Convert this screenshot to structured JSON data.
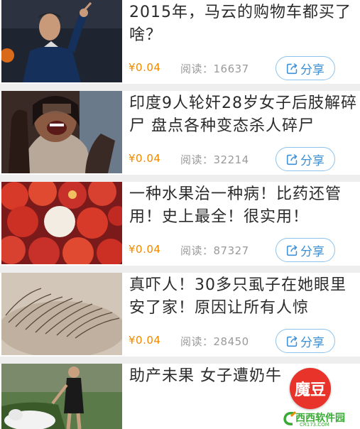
{
  "feed": {
    "items": [
      {
        "title": "2015年，马云的购物车都买了啥？",
        "price": "¥0.04",
        "reads": "阅读：16637",
        "share_label": "分享",
        "thumb": "man-on-stage-photo"
      },
      {
        "title": "印度9人轮奸28岁女子后肢解碎尸 盘点各种变态杀人碎尸",
        "price": "¥0.04",
        "reads": "阅读：32214",
        "share_label": "分享",
        "thumb": "screaming-woman-photo"
      },
      {
        "title": "一种水果治一种病！比药还管用！史上最全！很实用！",
        "price": "¥0.04",
        "reads": "阅读：87327",
        "share_label": "分享",
        "thumb": "lychee-fruit-photo"
      },
      {
        "title": "真吓人！30多只虱子在她眼里安了家！原因让所有人惊",
        "price": "¥0.04",
        "reads": "阅读：28450",
        "share_label": "分享",
        "thumb": "eyelash-closeup-photo"
      },
      {
        "title": "助产未果 女子遭奶牛",
        "thumb": "woman-with-cow-photo"
      }
    ]
  },
  "badge": {
    "label": "魔豆"
  },
  "watermark": {
    "brand": "西西软件园",
    "sub": "CR173.COM"
  },
  "colors": {
    "price": "#f08a00",
    "share": "#3a8fd6",
    "badge": "#e8332b",
    "watermark": "#3aa935"
  }
}
